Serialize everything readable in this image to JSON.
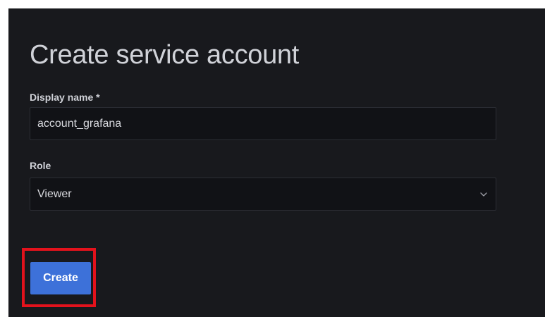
{
  "form": {
    "title": "Create service account",
    "display_name": {
      "label": "Display name *",
      "value": "account_grafana"
    },
    "role": {
      "label": "Role",
      "selected": "Viewer"
    },
    "submit_label": "Create"
  },
  "colors": {
    "background": "#18191d",
    "input_background": "#111216",
    "primary_button": "#3d71d9",
    "highlight_border": "#e3121c"
  },
  "icons": {
    "role_select_chevron": "chevron-down-icon"
  }
}
